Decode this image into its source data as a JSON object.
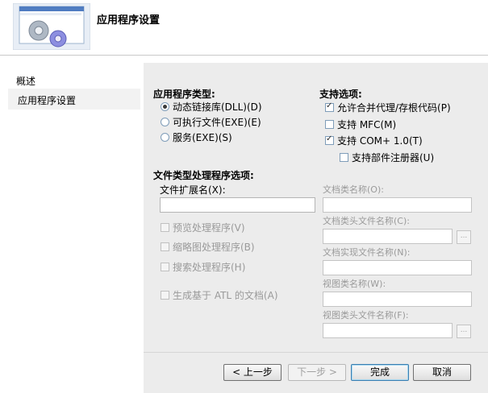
{
  "header": {
    "title": "应用程序设置"
  },
  "sidebar": {
    "items": [
      {
        "label": "概述"
      },
      {
        "label": "应用程序设置"
      }
    ]
  },
  "app_type": {
    "title": "应用程序类型:",
    "options": [
      {
        "label": "动态链接库(DLL)(D)",
        "selected": true
      },
      {
        "label": "可执行文件(EXE)(E)",
        "selected": false
      },
      {
        "label": "服务(EXE)(S)",
        "selected": false
      }
    ]
  },
  "support": {
    "title": "支持选项:",
    "options": [
      {
        "label": "允许合并代理/存根代码(P)",
        "checked": true
      },
      {
        "label": "支持 MFC(M)",
        "checked": false
      },
      {
        "label": "支持 COM+ 1.0(T)",
        "checked": true
      },
      {
        "label": "支持部件注册器(U)",
        "checked": false
      }
    ]
  },
  "file_handler": {
    "title": "文件类型处理程序选项:",
    "ext_label": "文件扩展名(X):",
    "ext_value": "",
    "checks": [
      {
        "label": "预览处理程序(V)"
      },
      {
        "label": "缩略图处理程序(B)"
      },
      {
        "label": "搜索处理程序(H)"
      },
      {
        "label": "生成基于 ATL 的文档(A)"
      }
    ],
    "doc_class_label": "文档类名称(O):",
    "doc_header_label": "文档类头文件名称(C):",
    "doc_impl_label": "文档实现文件名称(N):",
    "view_class_label": "视图类名称(W):",
    "view_header_label": "视图类头文件名称(F):",
    "browse_label": "..."
  },
  "buttons": {
    "prev": "< 上一步",
    "next": "下一步 >",
    "finish": "完成",
    "cancel": "取消"
  }
}
